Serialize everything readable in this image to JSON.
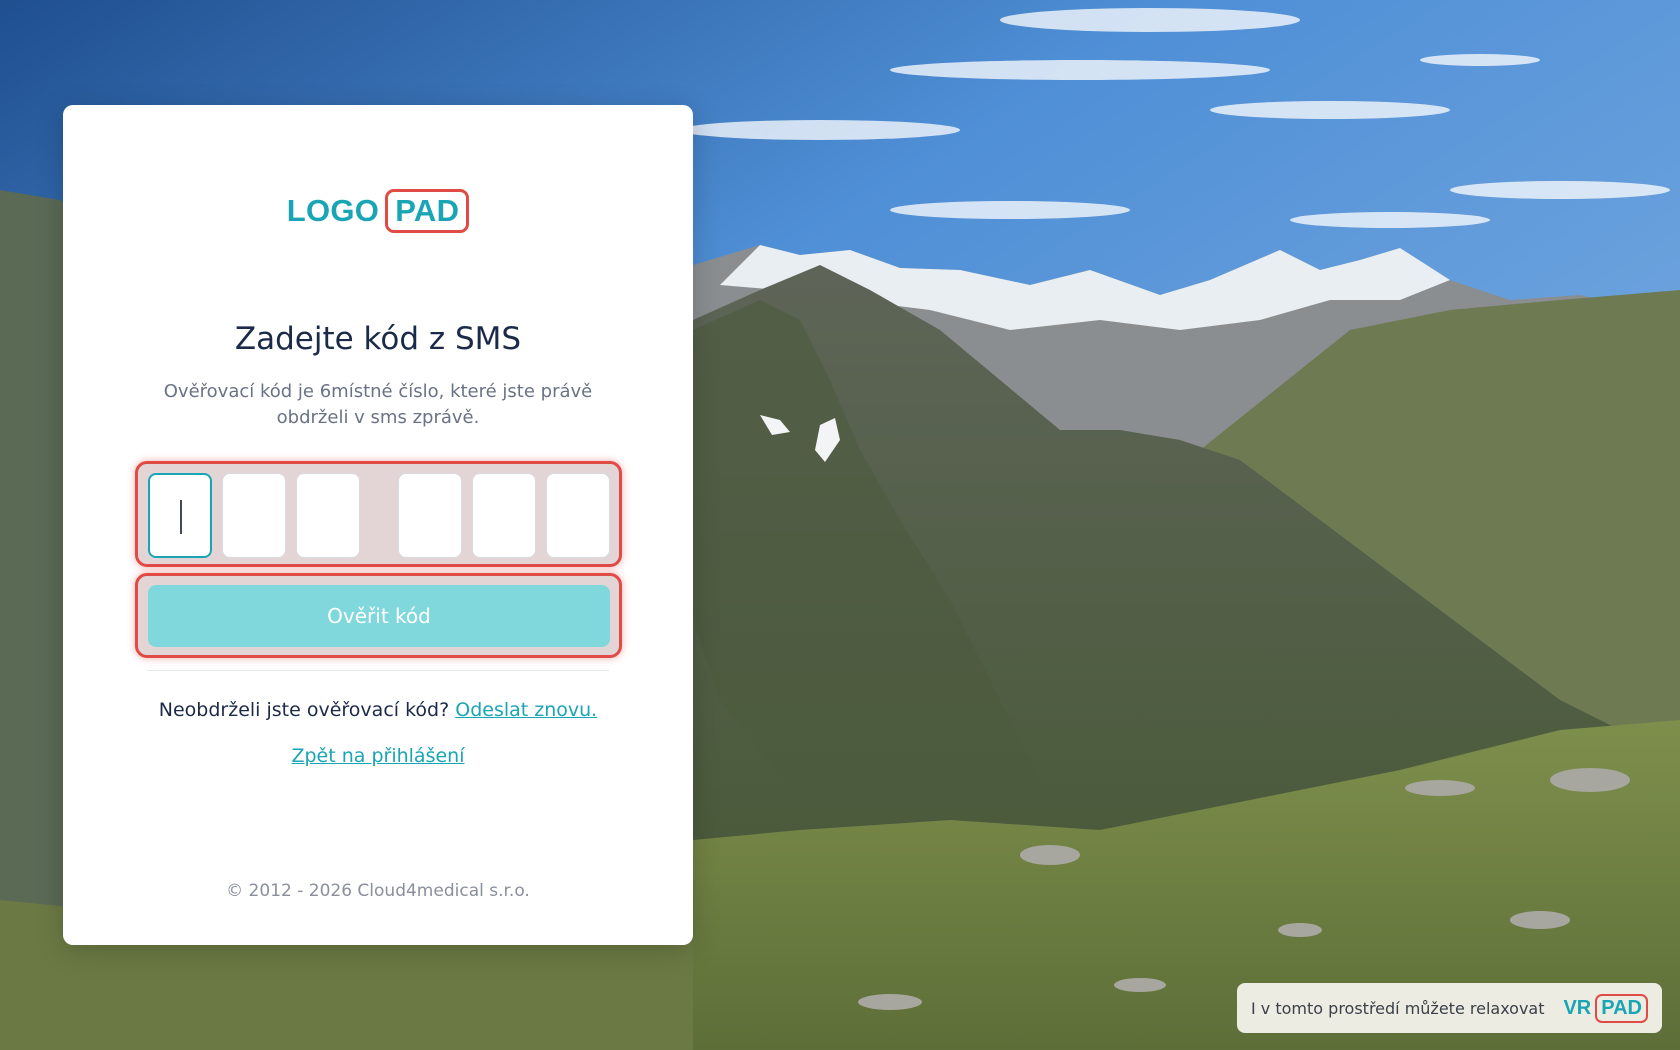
{
  "logo": {
    "part_a": "LOGO",
    "part_b": "PAD"
  },
  "heading": "Zadejte kód z SMS",
  "subtitle": "Ověřovací kód je 6místné číslo, které jste právě obdrželi v sms zprávě.",
  "otp": {
    "digits": [
      "",
      "",
      "",
      "",
      "",
      ""
    ],
    "length": 6
  },
  "verify_button": "Ověřit kód",
  "resend": {
    "text": "Neobdrželi jste ověřovací kód?",
    "link": "Odeslat znovu."
  },
  "back_link": "Zpět na přihlášení",
  "footer": "© 2012 - 2026 Cloud4medical s.r.o.",
  "badge": {
    "text": "I v tomto prostředí můžete relaxovat",
    "brand_a": "VR",
    "brand_b": "PAD"
  },
  "colors": {
    "accent": "#1aa5b5",
    "button": "#80d8dd",
    "highlight": "#e04b45",
    "heading": "#1c2a4a"
  }
}
